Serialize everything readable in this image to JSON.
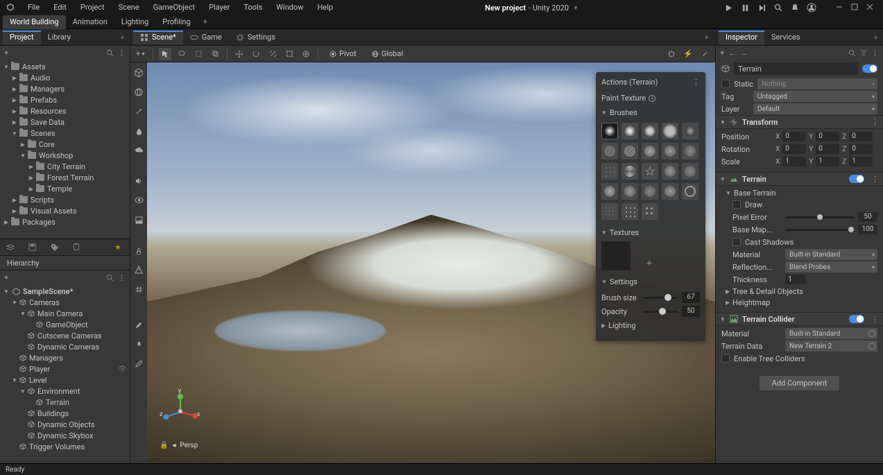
{
  "menubar": {
    "items": [
      "File",
      "Edit",
      "Project",
      "Scene",
      "GameObject",
      "Player",
      "Tools",
      "Window",
      "Help"
    ],
    "title_bold": "New project",
    "title_rest": " - Unity 2020"
  },
  "context_tabs": {
    "items": [
      "World Building",
      "Animation",
      "Lighting",
      "Profiling"
    ],
    "active": 0
  },
  "left_panel": {
    "tabs": [
      "Project",
      "Library"
    ],
    "active": 0,
    "assets": {
      "root": "Assets",
      "children": [
        {
          "label": "Audio",
          "depth": 1
        },
        {
          "label": "Managers",
          "depth": 1
        },
        {
          "label": "Prefabs",
          "depth": 1
        },
        {
          "label": "Resources",
          "depth": 1
        },
        {
          "label": "Save Data",
          "depth": 1
        },
        {
          "label": "Scenes",
          "depth": 1,
          "open": true,
          "children": [
            {
              "label": "Core",
              "depth": 2
            },
            {
              "label": "Workshop",
              "depth": 2,
              "open": true,
              "children": [
                {
                  "label": "City Terrain",
                  "depth": 3
                },
                {
                  "label": "Forest Terrain",
                  "depth": 3
                },
                {
                  "label": "Temple",
                  "depth": 3
                }
              ]
            }
          ]
        },
        {
          "label": "Scripts",
          "depth": 1
        },
        {
          "label": "Visual Assets",
          "depth": 1
        }
      ],
      "packages": "Packages"
    }
  },
  "hierarchy": {
    "title": "Hierarchy",
    "root": "SampleScene*",
    "nodes": [
      {
        "label": "Cameras",
        "depth": 1,
        "open": true,
        "children": [
          {
            "label": "Main Camera",
            "depth": 2,
            "open": true,
            "children": [
              {
                "label": "GameObject",
                "depth": 3
              }
            ]
          },
          {
            "label": "Cutscene Cameras",
            "depth": 2
          },
          {
            "label": "Dynamic Cameras",
            "depth": 2
          }
        ]
      },
      {
        "label": "Managers",
        "depth": 1
      },
      {
        "label": "Player",
        "depth": 1,
        "eye": true
      },
      {
        "label": "Level",
        "depth": 1,
        "open": true,
        "children": [
          {
            "label": "Environment",
            "depth": 2,
            "open": true,
            "children": [
              {
                "label": "Terrain",
                "depth": 3
              }
            ]
          },
          {
            "label": "Buildings",
            "depth": 2
          },
          {
            "label": "Dynamic Objects",
            "depth": 2
          },
          {
            "label": "Dynamic Skybox",
            "depth": 2
          }
        ]
      },
      {
        "label": "Trigger Volumes",
        "depth": 1
      }
    ]
  },
  "center": {
    "tabs": [
      {
        "label": "Scene*",
        "icon": "grid"
      },
      {
        "label": "Game",
        "icon": "goggles"
      },
      {
        "label": "Settings",
        "icon": "gear"
      }
    ],
    "active": 0,
    "toolbar": {
      "pivot": "Pivot",
      "global": "Global"
    },
    "orientation": "Persp",
    "axes": {
      "x": "x",
      "y": "y",
      "z": "z"
    }
  },
  "actions": {
    "title": "Actions (Terrain)",
    "subtitle": "Paint Texture",
    "sections": {
      "brushes": "Brushes",
      "textures": "Textures",
      "settings": "Settings",
      "lighting": "Lighting"
    },
    "brush_size_label": "Brush size",
    "brush_size": 67,
    "opacity_label": "Opacity",
    "opacity": 50
  },
  "inspector": {
    "tabs": [
      "Inspector",
      "Services"
    ],
    "active": 0,
    "object_name": "Terrain",
    "static_label": "Static",
    "static_dd": "Nothing",
    "tag_label": "Tag",
    "tag_value": "Untagged",
    "layer_label": "Layer",
    "layer_value": "Default",
    "transform": {
      "title": "Transform",
      "position": {
        "label": "Position",
        "x": "0",
        "y": "0",
        "z": "0"
      },
      "rotation": {
        "label": "Rotation",
        "x": "0",
        "y": "0",
        "z": "0"
      },
      "scale": {
        "label": "Scale",
        "x": "1",
        "y": "1",
        "z": "1"
      }
    },
    "terrain": {
      "title": "Terrain",
      "base_terrain": "Base Terrain",
      "draw": "Draw",
      "pixel_error_label": "Pixel Error",
      "pixel_error": 50,
      "base_map_label": "Base Map...",
      "base_map": 100,
      "cast_shadows": "Cast Shadows",
      "material_label": "Material",
      "material_value": "Built-in Standard",
      "reflection_label": "Reflection...",
      "reflection_value": "Blend Probes",
      "thickness_label": "Thickness",
      "thickness_value": "1",
      "tree_detail": "Tree & Detail Objects",
      "heightmap": "Heightmap"
    },
    "collider": {
      "title": "Terrain Collider",
      "material_label": "Material",
      "material_value": "Built-in Standard",
      "terrain_data_label": "Terrain Data",
      "terrain_data_value": "New Terrain 2",
      "enable_tree": "Enable Tree Colliders"
    },
    "add_component": "Add Component"
  },
  "status": {
    "text": "Ready"
  }
}
